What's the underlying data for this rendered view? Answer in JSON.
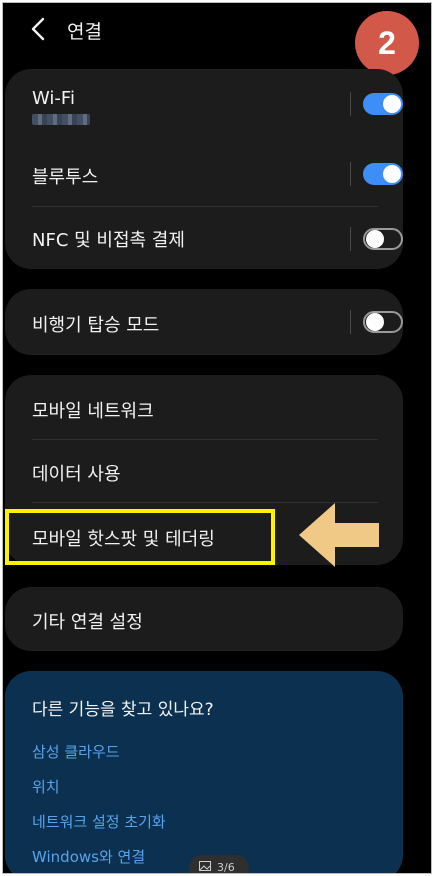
{
  "header": {
    "title": "연결"
  },
  "badge": {
    "text": "2",
    "color": "#d2594a"
  },
  "groups": {
    "wireless": {
      "wifi": {
        "label": "Wi-Fi",
        "enabled": true
      },
      "bluetooth": {
        "label": "블루투스",
        "enabled": true
      },
      "nfc": {
        "label": "NFC 및 비접촉 결제",
        "enabled": false
      }
    },
    "airplane": {
      "label": "비행기 탑승 모드",
      "enabled": false
    },
    "network": {
      "items": [
        "모바일 네트워크",
        "데이터 사용",
        "모바일 핫스팟 및 테더링"
      ]
    },
    "more": {
      "label": "기타 연결 설정"
    }
  },
  "suggestions": {
    "title": "다른 기능을 찾고 있나요?",
    "links": [
      "삼성 클라우드",
      "위치",
      "네트워크 설정 초기화",
      "Windows와 연결"
    ]
  },
  "pager": {
    "text": "3/6"
  },
  "colors": {
    "toggle_on": "#3e8ef7",
    "highlight": "#fff200",
    "arrow": "#f0c987",
    "link": "#58a3ec"
  }
}
